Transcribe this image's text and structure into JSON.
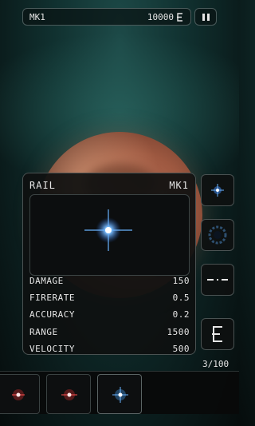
{
  "topbar": {
    "ship_name": "MK1",
    "credits": "10000",
    "credits_icon": "euro-icon"
  },
  "weapon": {
    "name": "RAIL",
    "level": "MK1"
  },
  "stats": [
    {
      "label": "DAMAGE",
      "value": "150"
    },
    {
      "label": "FIRERATE",
      "value": "0.5"
    },
    {
      "label": "ACCURACY",
      "value": "0.2"
    },
    {
      "label": "RANGE",
      "value": "1500"
    },
    {
      "label": "VELOCITY",
      "value": "500"
    }
  ],
  "side_buttons": [
    "spark-icon",
    "vortex-icon",
    "dash-icon",
    "euro-icon"
  ],
  "count": "3/100",
  "slots": [
    {
      "icon": "red-spark-icon",
      "color": "#e03030"
    },
    {
      "icon": "red-spark-icon",
      "color": "#e03030"
    },
    {
      "icon": "blue-spark-icon",
      "color": "#4aa8ff"
    }
  ]
}
